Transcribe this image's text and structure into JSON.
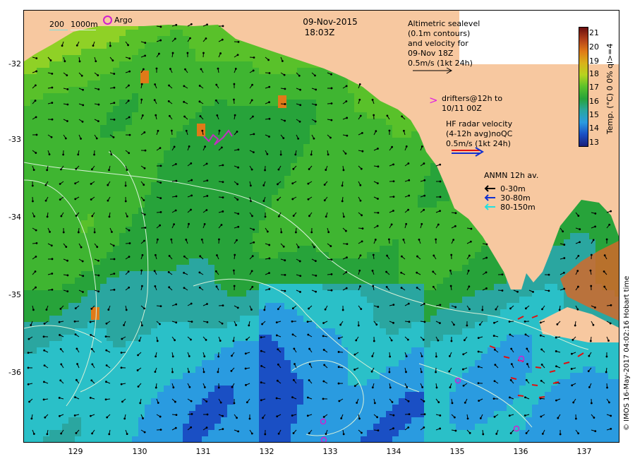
{
  "map": {
    "date": "09-Nov-2015",
    "time": "18:03Z",
    "copyright": "© IMOS 16-May-2017 04:02:16 Hobart time",
    "colors": {
      "land": "#f7c8a0",
      "warm": "#e07a18",
      "cool": "#2a9be0",
      "cold": "#1a2f9a",
      "mid": "#59c12a",
      "contour": "#d8f0d8"
    },
    "latitude_ticks": [
      "-32",
      "-33",
      "-34",
      "-35",
      "-36"
    ],
    "longitude_ticks": [
      "129",
      "130",
      "131",
      "132",
      "133",
      "134",
      "135",
      "136",
      "137"
    ]
  },
  "legend": {
    "bathymetry": {
      "depth1": "200",
      "depth2": "1000m"
    },
    "argo": {
      "label": "Argo"
    },
    "altimetry": {
      "line1": "Altimetric sealevel",
      "line2": "(0.1m contours)",
      "line3": "and velocity for",
      "line4": "09-Nov 18Z",
      "line5": "0.5m/s (1kt 24h)"
    },
    "drifters": {
      "line1": "drifters@12h to",
      "line2": "10/11 00Z"
    },
    "hf_radar": {
      "line1": "HF radar velocity",
      "line2": "(4-12h avg)noQC",
      "line3": "0.5m/s (1kt 24h)"
    },
    "anmn": {
      "title": "ANMN 12h av.",
      "items": [
        {
          "label": "0-30m",
          "color": "#000000"
        },
        {
          "label": "30-80m",
          "color": "#1030d0"
        },
        {
          "label": "80-150m",
          "color": "#20e0e0"
        }
      ]
    }
  },
  "colorbar": {
    "title": "Temp. (°C) 0 0% ql>=4",
    "ticks": [
      "21",
      "20",
      "19",
      "18",
      "17",
      "16",
      "15",
      "14",
      "13"
    ],
    "colors": [
      "#6b0f0f",
      "#b2401a",
      "#e07a18",
      "#d9b21a",
      "#b6d31e",
      "#59c12a",
      "#27a33a",
      "#2aa6a0",
      "#2a9be0",
      "#1a4fc4",
      "#1a1f7a"
    ]
  }
}
